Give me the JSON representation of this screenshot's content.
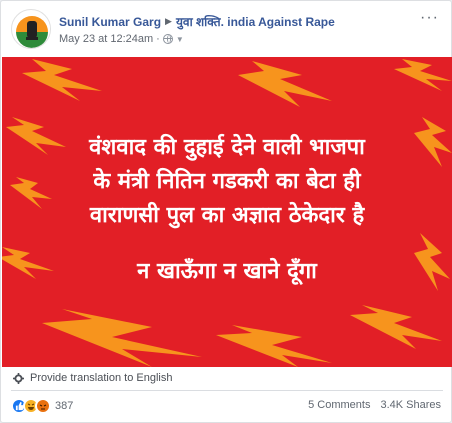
{
  "post": {
    "author": "Sunil Kumar Garg",
    "group": "युवा शक्ति. india Against Rape",
    "timestamp": "May 23 at 12:24am",
    "privacy_separator": "·",
    "more_icon": "more-horizontal-icon"
  },
  "image": {
    "background_color": "#e21f26",
    "text_color": "#ffffff",
    "accent_color": "#f7941d",
    "lines": [
      "वंशवाद की दुहाई देने वाली भाजपा",
      "के मंत्री नितिन गडकरी का बेटा ही",
      "वाराणसी पुल का अज्ञात ठेकेदार है",
      "न खाऊँगा न खाने दूँगा"
    ]
  },
  "translation": {
    "label": "Provide translation to English",
    "icon": "gear-icon"
  },
  "engagement": {
    "reaction_icons": [
      "like-icon",
      "haha-icon",
      "angry-icon"
    ],
    "reaction_count": "387",
    "comments": "5 Comments",
    "shares": "3.4K Shares"
  },
  "colors": {
    "link_blue": "#385898",
    "meta_gray": "#616770"
  }
}
